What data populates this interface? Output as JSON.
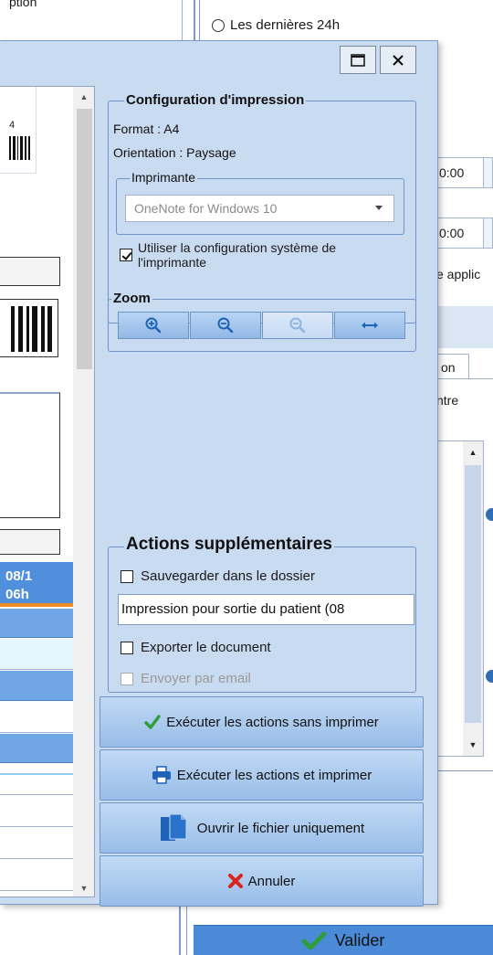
{
  "background": {
    "topleft_label": "ption",
    "radio_label": "Les dernières 24h",
    "time1": "0:00",
    "time2": "0:00",
    "applic_text": "e applic",
    "tab_label": "on",
    "ntre_text": "ntre",
    "valider_label": "Valider"
  },
  "dialog": {
    "preview": {
      "label_4": "4",
      "date_header": "08/1",
      "time_header": "06h"
    },
    "print_config": {
      "legend": "Configuration d'impression",
      "format": "Format : A4",
      "orientation": "Orientation : Paysage",
      "printer_legend": "Imprimante",
      "printer_selected": "OneNote for Windows 10",
      "use_system_config_label": "Utiliser la configuration système de l'imprimante",
      "use_system_config_checked": true
    },
    "zoom": {
      "legend": "Zoom"
    },
    "actions": {
      "legend": "Actions supplémentaires",
      "save_folder_label": "Sauvegarder dans le dossier",
      "save_folder_checked": false,
      "document_name_value": "Impression pour sortie du patient (08",
      "export_label": "Exporter le document",
      "export_checked": false,
      "email_label": "Envoyer par email",
      "email_checked": false
    },
    "buttons": {
      "execute_no_print": "Exécuter les actions sans imprimer",
      "execute_print": "Exécuter les actions et imprimer",
      "open_file": "Ouvrir le fichier uniquement",
      "cancel": "Annuler"
    }
  },
  "colors": {
    "dialog_bg": "#c9dbf0",
    "group_border": "#6f95c6",
    "button_blue": "#98bde8",
    "icon_blue": "#1f63b8",
    "check_green": "#2e9e3a",
    "cancel_red": "#d9251c",
    "table_header": "#4f8fdc",
    "orange_accent": "#f08a24"
  }
}
